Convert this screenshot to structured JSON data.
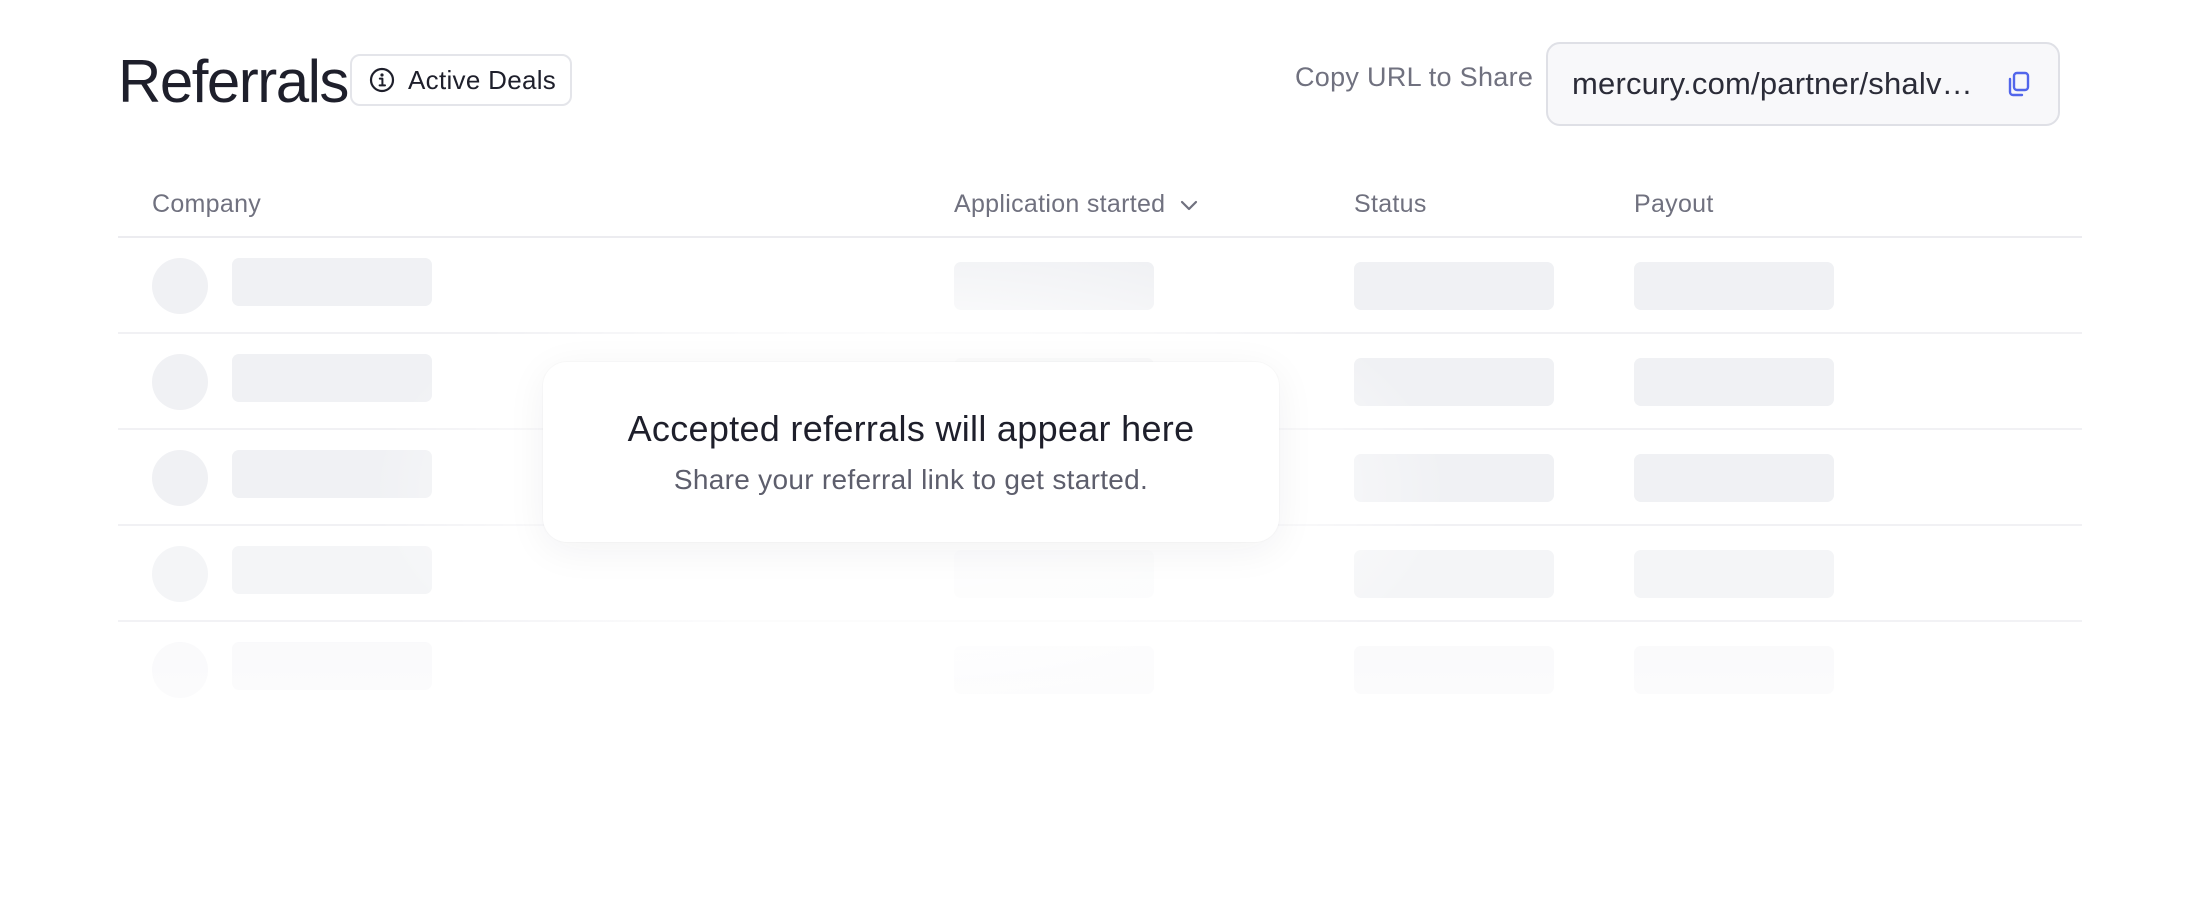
{
  "header": {
    "title": "Referrals",
    "active_deals_label": "Active Deals",
    "copy_label": "Copy URL to Share",
    "share_url": "mercury.com/partner/shalva-…"
  },
  "table": {
    "columns": {
      "company": "Company",
      "application_started": "Application started",
      "status": "Status",
      "payout": "Payout"
    }
  },
  "empty_state": {
    "title": "Accepted referrals will appear here",
    "subtitle": "Share your referral link to get started."
  },
  "colors": {
    "text_primary": "#1e1f2b",
    "text_muted": "#70717f",
    "skeleton": "#f0f1f4",
    "accent_icon": "#5266eb"
  },
  "icons": {
    "active_deals": "info-circle-icon",
    "copy": "copy-icon",
    "sort": "chevron-down-icon"
  }
}
